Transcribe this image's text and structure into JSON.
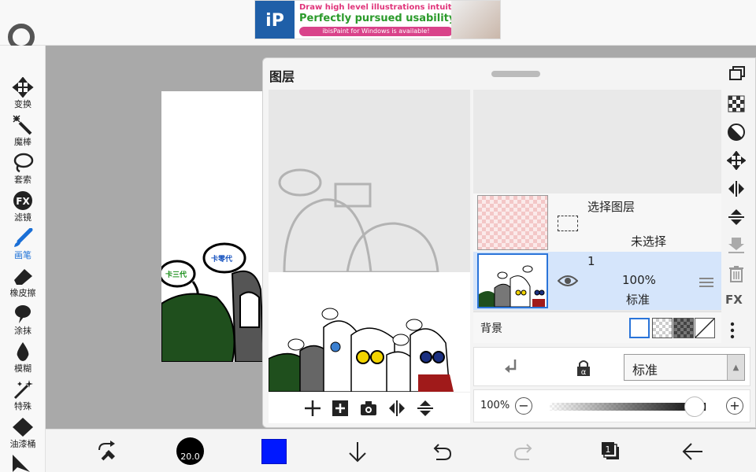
{
  "ad": {
    "logo_text": "iP",
    "line1": "Draw high level illustrations intuitively!",
    "line2": "Perfectly pursued usability!",
    "line3": "ibisPaint for Windows is available!"
  },
  "tools": [
    {
      "label": "变换",
      "icon": "move-icon"
    },
    {
      "label": "魔棒",
      "icon": "magic-wand-icon"
    },
    {
      "label": "套索",
      "icon": "lasso-icon"
    },
    {
      "label": "滤镜",
      "icon": "fx-filter-icon",
      "glyph": "FX"
    },
    {
      "label": "画笔",
      "icon": "brush-icon",
      "active": true
    },
    {
      "label": "橡皮擦",
      "icon": "eraser-icon"
    },
    {
      "label": "涂抹",
      "icon": "smudge-icon"
    },
    {
      "label": "模糊",
      "icon": "blur-icon"
    },
    {
      "label": "特殊",
      "icon": "special-icon"
    },
    {
      "label": "油漆桶",
      "icon": "bucket-icon"
    }
  ],
  "canvas": {
    "bubble1": "卡三代",
    "bubble2": "卡零代"
  },
  "layer_panel": {
    "title": "图层",
    "selection_layer": {
      "name": "选择图层",
      "status": "未选择"
    },
    "layer1": {
      "number": "1",
      "opacity": "100%",
      "blend": "标准"
    },
    "background_label": "背景",
    "blend_mode": "标准",
    "opacity_label": "100%",
    "opacity_value": 0.93,
    "minus": "−",
    "plus": "+",
    "fx_label": "FX"
  },
  "bottom": {
    "brush_size": "20.0",
    "color": "#0018ff",
    "layer_count": "1"
  }
}
